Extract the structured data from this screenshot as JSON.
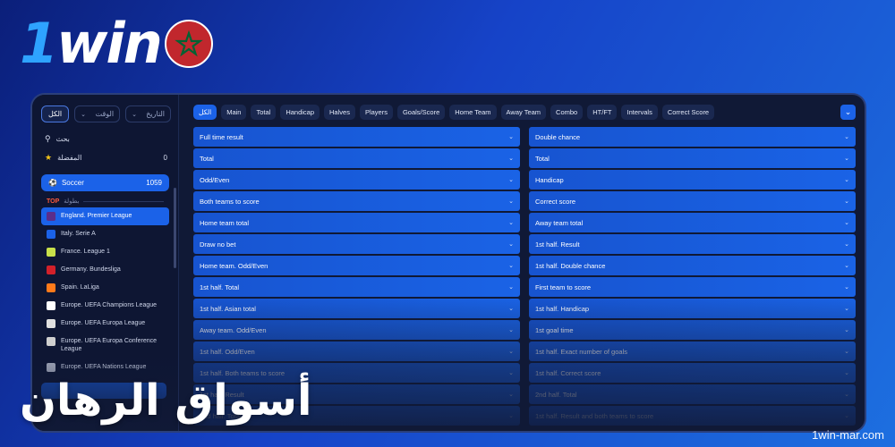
{
  "brand": {
    "logo_one": "1",
    "logo_rest": "win",
    "flag_icon": "morocco-flag-icon",
    "site_url": "1win-mar.com"
  },
  "headline": "أسواق الرهان",
  "sidebar": {
    "filter_all": "الكل",
    "filter_time": "الوقت",
    "filter_date": "التاريخ",
    "search_label": "بحث",
    "favorites_label": "المفضلة",
    "favorites_count": "0",
    "sport": {
      "name": "Soccer",
      "count": "1059"
    },
    "top_badge": "TOP",
    "top_label": "بطولة",
    "leagues": [
      {
        "name": "England. Premier League",
        "icon": "premier-league-icon",
        "color": "#5b2d8a",
        "active": true
      },
      {
        "name": "Italy. Serie A",
        "icon": "serie-a-icon",
        "color": "#1b62e8"
      },
      {
        "name": "France. League 1",
        "icon": "ligue-1-icon",
        "color": "#c8e04a"
      },
      {
        "name": "Germany. Bundesliga",
        "icon": "bundesliga-icon",
        "color": "#d2202a"
      },
      {
        "name": "Spain. LaLiga",
        "icon": "laliga-icon",
        "color": "#ff7a1a"
      },
      {
        "name": "Europe. UEFA Champions League",
        "icon": "champions-league-icon",
        "color": "#ffffff"
      },
      {
        "name": "Europe. UEFA Europa League",
        "icon": "europa-league-icon",
        "color": "#e0e0e0"
      },
      {
        "name": "Europe. UEFA Europa Conference League",
        "icon": "conference-league-icon",
        "color": "#cfcfcf"
      },
      {
        "name": "Europe. UEFA Nations League",
        "icon": "nations-league-icon",
        "color": "#aab0c2"
      }
    ]
  },
  "tabs": [
    "الكل",
    "Main",
    "Total",
    "Handicap",
    "Halves",
    "Players",
    "Goals/Score",
    "Home Team",
    "Away Team",
    "Combo",
    "HT/FT",
    "Intervals",
    "Correct Score"
  ],
  "markets_left": [
    "Full time result",
    "Total",
    "Odd/Even",
    "Both teams to score",
    "Home team total",
    "Draw no bet",
    "Home team. Odd/Even",
    "1st half. Total",
    "1st half. Asian total",
    "Away team. Odd/Even",
    "1st half. Odd/Even",
    "1st half. Both teams to score",
    "1st half. Result",
    "2nd half. Total"
  ],
  "markets_right": [
    "Double chance",
    "Total",
    "Handicap",
    "Correct score",
    "Away team total",
    "1st half. Result",
    "1st half. Double chance",
    "First team to score",
    "1st half. Handicap",
    "1st goal time",
    "1st half. Exact number of goals",
    "1st half. Correct score",
    "2nd half. Total",
    "1st half. Result and both teams to score"
  ],
  "colors": {
    "accent": "#1b62e8",
    "panel": "#101936",
    "top_badge": "#ff5a3a"
  }
}
